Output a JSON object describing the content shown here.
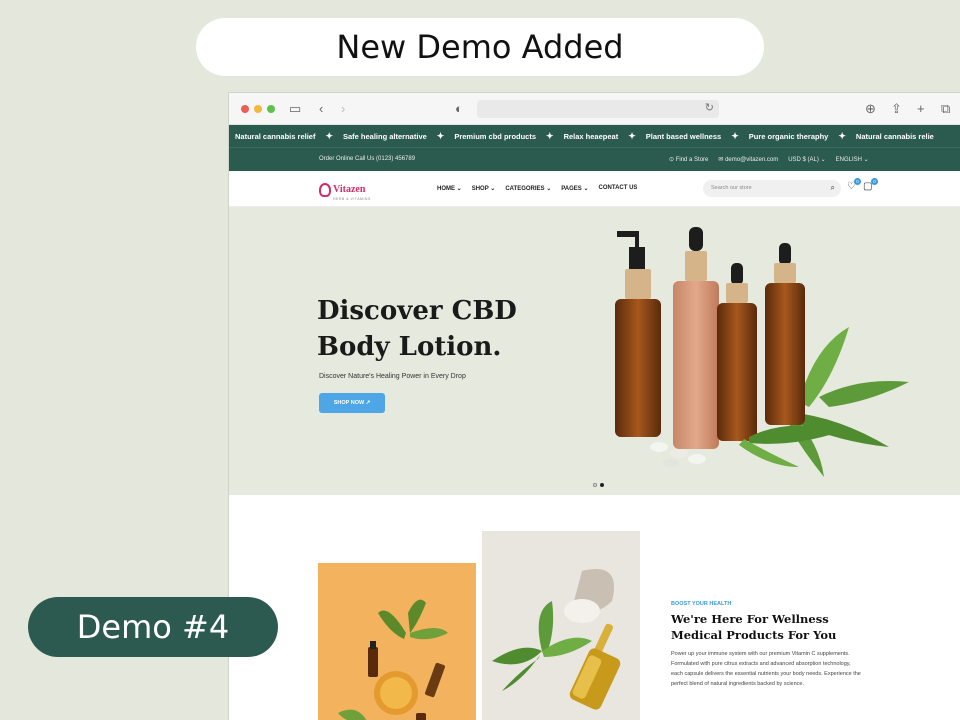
{
  "banner": {
    "headline": "New Demo Added",
    "demo_label": "Demo #4"
  },
  "browser": {
    "url": ""
  },
  "ticker": {
    "items": [
      "Natural cannabis relief",
      "Safe healing alternative",
      "Premium cbd products",
      "Relax heaepeat",
      "Plant based wellness",
      "Pure organic theraphy",
      "Natural cannabis relie"
    ]
  },
  "topbar": {
    "phone": "Order Online Call Us (0123) 456789",
    "store": "Find a Store",
    "email": "demo@vitazen.com",
    "currency": "USD $ (AL)",
    "language": "ENGLISH"
  },
  "header": {
    "logo": "Vitazen",
    "logo_tagline": "HERB & VITAMINS",
    "menu": [
      "HOME",
      "SHOP",
      "CATEGORIES",
      "PAGES",
      "CONTACT US"
    ],
    "search_placeholder": "Search our store",
    "wishlist_count": "0",
    "cart_count": "0"
  },
  "hero": {
    "title": "Discover CBD Body Lotion.",
    "subtitle": "Discover Nature's Healing Power in Every Drop",
    "cta": "SHOP NOW ↗"
  },
  "about": {
    "eyebrow": "BOOST YOUR HEALTH",
    "title": "We're Here For Wellness Medical Products For You",
    "body": "Power up your immune system with our premium Vitamin C supplements. Formulated with pure citrus extracts and advanced absorption technology, each capsule delivers the essential nutrients your body needs. Experience the perfect blend of natural ingredients backed by science."
  },
  "colors": {
    "brand": "#2b5a4f",
    "accent": "#4ea6e6",
    "logo": "#d02c6a",
    "hero_bg": "#e6e9dd"
  }
}
